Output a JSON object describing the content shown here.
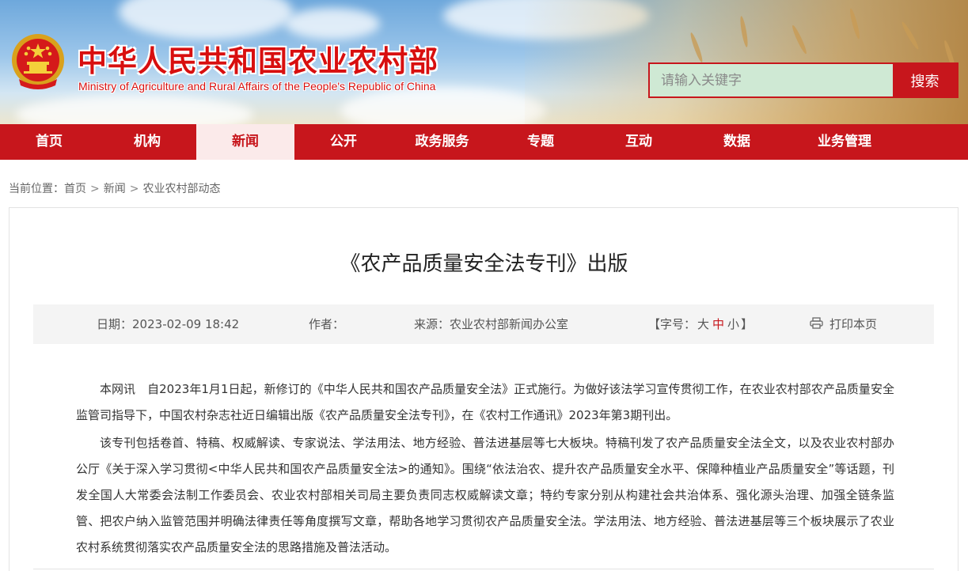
{
  "colors": {
    "brand_red": "#c7161c",
    "search_bg": "#cfe9d4",
    "meta_bg": "#f4f4f4"
  },
  "header": {
    "title_cn": "中华人民共和国农业农村部",
    "title_en": "Ministry of Agriculture and Rural Affairs of the People's Republic of China",
    "emblem_icon": "national-emblem-icon",
    "search": {
      "placeholder": "请输入关键字",
      "button_label": "搜索"
    }
  },
  "nav": {
    "items": [
      {
        "label": "首页"
      },
      {
        "label": "机构"
      },
      {
        "label": "新闻",
        "active": true
      },
      {
        "label": "公开"
      },
      {
        "label": "政务服务"
      },
      {
        "label": "专题"
      },
      {
        "label": "互动"
      },
      {
        "label": "数据"
      },
      {
        "label": "业务管理"
      }
    ]
  },
  "breadcrumb": {
    "prefix": "当前位置：",
    "items": [
      "首页",
      "新闻",
      "农业农村部动态"
    ],
    "separator": ">"
  },
  "article": {
    "title": "《农产品质量安全法专刊》出版",
    "meta": {
      "date_label": "日期：",
      "date": "2023-02-09 18:42",
      "author_label": "作者：",
      "author": "",
      "source_label": "来源：",
      "source": "农业农村部新闻办公室",
      "fontsize_prefix": "【字号：",
      "fontsize_big": "大",
      "fontsize_mid": "中",
      "fontsize_small": "小",
      "fontsize_suffix": "】",
      "print_icon": "printer-icon",
      "print_label": "打印本页"
    },
    "paragraphs": [
      "本网讯　自2023年1月1日起，新修订的《中华人民共和国农产品质量安全法》正式施行。为做好该法学习宣传贯彻工作，在农业农村部农产品质量安全监管司指导下，中国农村杂志社近日编辑出版《农产品质量安全法专刊》，在《农村工作通讯》2023年第3期刊出。",
      "该专刊包括卷首、特稿、权威解读、专家说法、学法用法、地方经验、普法进基层等七大板块。特稿刊发了农产品质量安全法全文，以及农业农村部办公厅《关于深入学习贯彻<中华人民共和国农产品质量安全法>的通知》。围绕“依法治农、提升农产品质量安全水平、保障种植业产品质量安全”等话题，刊发全国人大常委会法制工作委员会、农业农村部相关司局主要负责同志权威解读文章；特约专家分别从构建社会共治体系、强化源头治理、加强全链条监管、把农户纳入监管范围并明确法律责任等角度撰写文章，帮助各地学习贯彻农产品质量安全法。学法用法、地方经验、普法进基层等三个板块展示了农业农村系统贯彻落实农产品质量安全法的思路措施及普法活动。"
    ]
  }
}
